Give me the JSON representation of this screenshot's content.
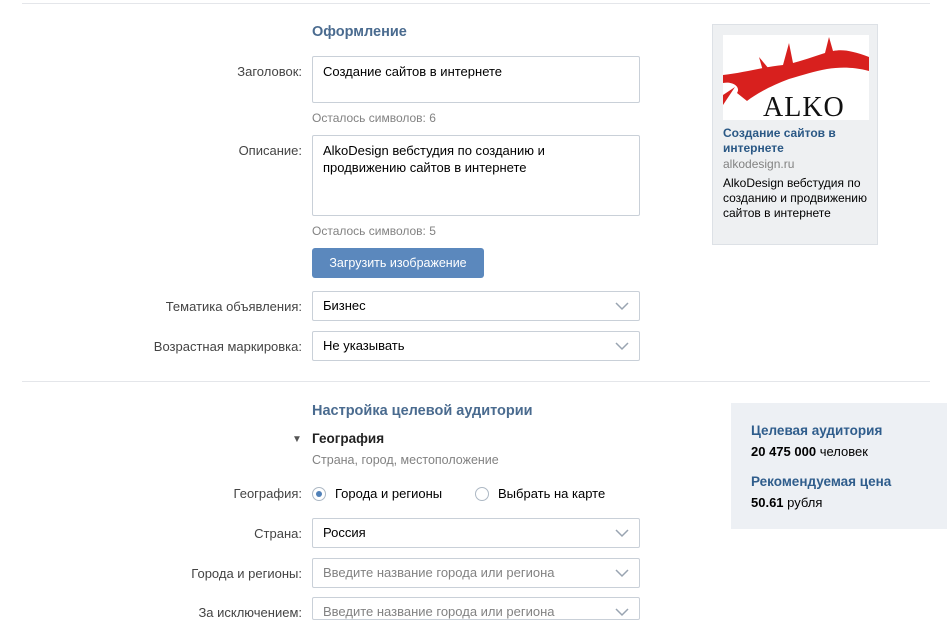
{
  "design": {
    "section_title": "Оформление",
    "title_label": "Заголовок:",
    "title_value": "Создание сайтов в интернете",
    "title_hint": "Осталось символов: 6",
    "desc_label": "Описание:",
    "desc_value": "AlkoDesign вебстудия по созданию и продвижению сайтов в интернете",
    "desc_hint": "Осталось символов: 5",
    "upload_button": "Загрузить изображение",
    "topic_label": "Тематика объявления:",
    "topic_value": "Бизнес",
    "age_label": "Возрастная маркировка:",
    "age_value": "Не указывать"
  },
  "preview": {
    "logo_text": "ALKO",
    "title": "Создание сайтов в интернете",
    "domain": "alkodesign.ru",
    "description": "AlkoDesign вебстудия по созданию и продвижению сайтов в интернете"
  },
  "audience_setup": {
    "section_title": "Настройка целевой аудитории",
    "geo_title": "География",
    "geo_subtitle": "Страна, город, местоположение",
    "geo_label": "География:",
    "geo_option_1": "Города и регионы",
    "geo_option_2": "Выбрать на карте",
    "country_label": "Страна:",
    "country_value": "Россия",
    "cities_label": "Города и регионы:",
    "cities_placeholder": "Введите название города или региона",
    "except_label": "За исключением:",
    "except_placeholder": "Введите название города или региона"
  },
  "audience_box": {
    "target_title": "Целевая аудитория",
    "target_count": "20 475 000",
    "target_unit": "человек",
    "price_title": "Рекомендуемая цена",
    "price_value": "50.61",
    "price_unit": "рубля"
  },
  "colors": {
    "accent": "#5b88bd",
    "link": "#2a5885",
    "section_title": "#4a6b8f",
    "logo_red": "#d8201e"
  }
}
